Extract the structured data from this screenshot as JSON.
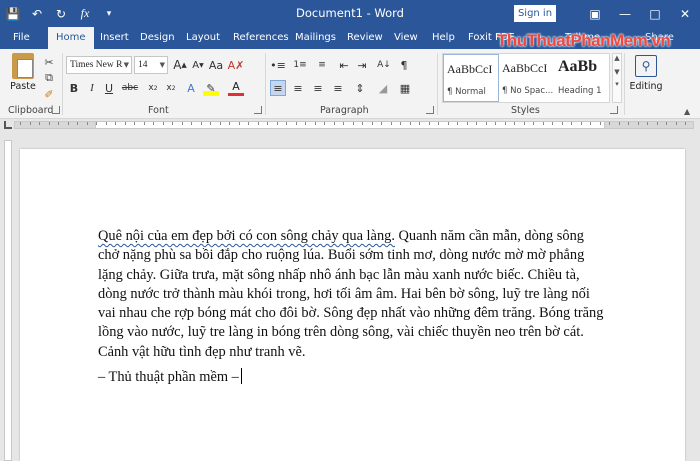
{
  "title_bar": {
    "document_title": "Document1 - Word",
    "sign_in": "Sign in"
  },
  "tabs": [
    "File",
    "Home",
    "Insert",
    "Design",
    "Layout",
    "References",
    "Mailings",
    "Review",
    "View",
    "Help",
    "Foxit PDF"
  ],
  "active_tab": "Home",
  "tell_me": "Tell me",
  "share": "Share",
  "watermark": "ThuThuatPhanMem.vn",
  "ribbon": {
    "clipboard": {
      "paste_label": "Paste",
      "group_label": "Clipboard"
    },
    "font": {
      "font_name": "Times New R",
      "font_size": "14",
      "group_label": "Font"
    },
    "paragraph": {
      "group_label": "Paragraph"
    },
    "styles": {
      "group_label": "Styles",
      "items": [
        {
          "preview": "AaBbCcI",
          "name": "¶ Normal"
        },
        {
          "preview": "AaBbCcI",
          "name": "¶ No Spac..."
        },
        {
          "preview": "AaBb",
          "name": "Heading 1"
        }
      ]
    },
    "editing": {
      "label": "Editing"
    }
  },
  "document": {
    "paragraph_start": "Quê nội của em đẹp bởi có con sông chảy qua làng.",
    "paragraph_rest": " Quanh năm cần mẫn, dòng sông chở nặng phù sa bồi đắp cho ruộng lúa. Buổi sớm tinh mơ, dòng nước mờ mờ phẳng lặng chảy. Giữa trưa, mặt sông nhấp nhô ánh bạc lẫn màu xanh nước biếc. Chiều tà, dòng nước trở thành màu khói trong, hơi tối âm âm. Hai bên bờ sông, luỹ tre làng nối vai nhau che rợp bóng mát cho đôi bờ. Sông đẹp nhất vào những đêm trăng. Bóng trăng lồng vào nước, luỹ tre làng in bóng trên dòng sông, vài chiếc thuyền neo trên bờ cát. Cảnh vật hữu tình đẹp như tranh vẽ.",
    "signature": "– Thủ thuật phần mềm –"
  },
  "colors": {
    "title_bar": "#2b579a",
    "ribbon": "#f3f3f3",
    "watermark": "#f0483e"
  }
}
